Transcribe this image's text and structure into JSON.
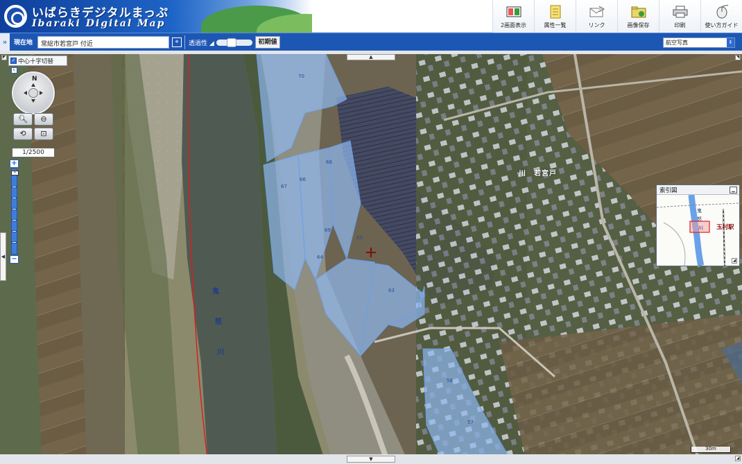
{
  "header": {
    "title": "いばらきデジタルまっぷ",
    "subtitle": "Ibaraki Digital Map",
    "tools": [
      {
        "label": "2画面表示",
        "icon": "dual-screen-icon"
      },
      {
        "label": "属性一覧",
        "icon": "attribute-list-icon"
      },
      {
        "label": "リンク",
        "icon": "link-mail-icon"
      },
      {
        "label": "画像保存",
        "icon": "image-save-icon"
      },
      {
        "label": "印刷",
        "icon": "print-icon"
      },
      {
        "label": "使い方ガイド",
        "icon": "guide-mouse-icon"
      }
    ]
  },
  "locbar": {
    "label": "現在地",
    "location": "常総市若宮戸 付近",
    "opacity_label": "透過性 ◢",
    "opacity_value": 0.4,
    "reset_label": "初期値",
    "layer_selected": "航空写真"
  },
  "controls": {
    "crosshair_label": "中心十字切替",
    "crosshair_checked": true,
    "compass_north": "N",
    "scale_label": "1/2500"
  },
  "index_map": {
    "title": "索引図",
    "station": "玉村駅",
    "river_chars": [
      "鬼",
      "怒",
      "川"
    ]
  },
  "map": {
    "river_label_chars": [
      "鬼",
      "怒",
      "川"
    ],
    "place_name": "川　若宮戸",
    "parcel_numbers": [
      "70",
      "69",
      "68",
      "67",
      "66",
      "65",
      "64",
      "63",
      "58",
      "57"
    ],
    "scalebar": "30m"
  },
  "colors": {
    "header_blue": "#1d57b4",
    "parcel_overlay": "#8fb8f0",
    "solar_panels": "#3f4560",
    "river": "#4f5a52",
    "boundary_line": "#d62020"
  }
}
